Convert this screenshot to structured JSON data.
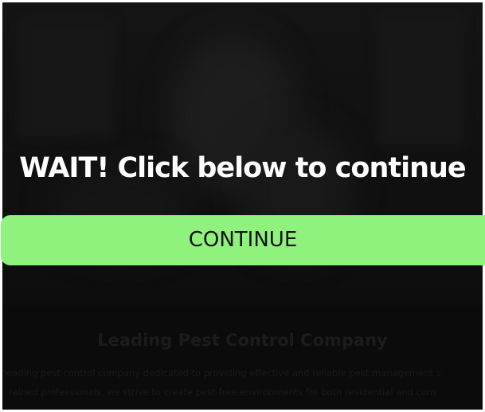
{
  "popup": {
    "headline": "WAIT! Click below to continue",
    "button_label": "CONTINUE"
  },
  "background": {
    "heading": "Leading Pest Control Company",
    "paragraph_line_1": "leading pest control company dedicated to providing effective and reliable pest management s",
    "paragraph_line_2": "rained professionals, we strive to create pest-free environments for both residential and com"
  },
  "colors": {
    "overlay": "#0b0b0b",
    "button": "#8ef27c",
    "headline_text": "#ffffff"
  }
}
